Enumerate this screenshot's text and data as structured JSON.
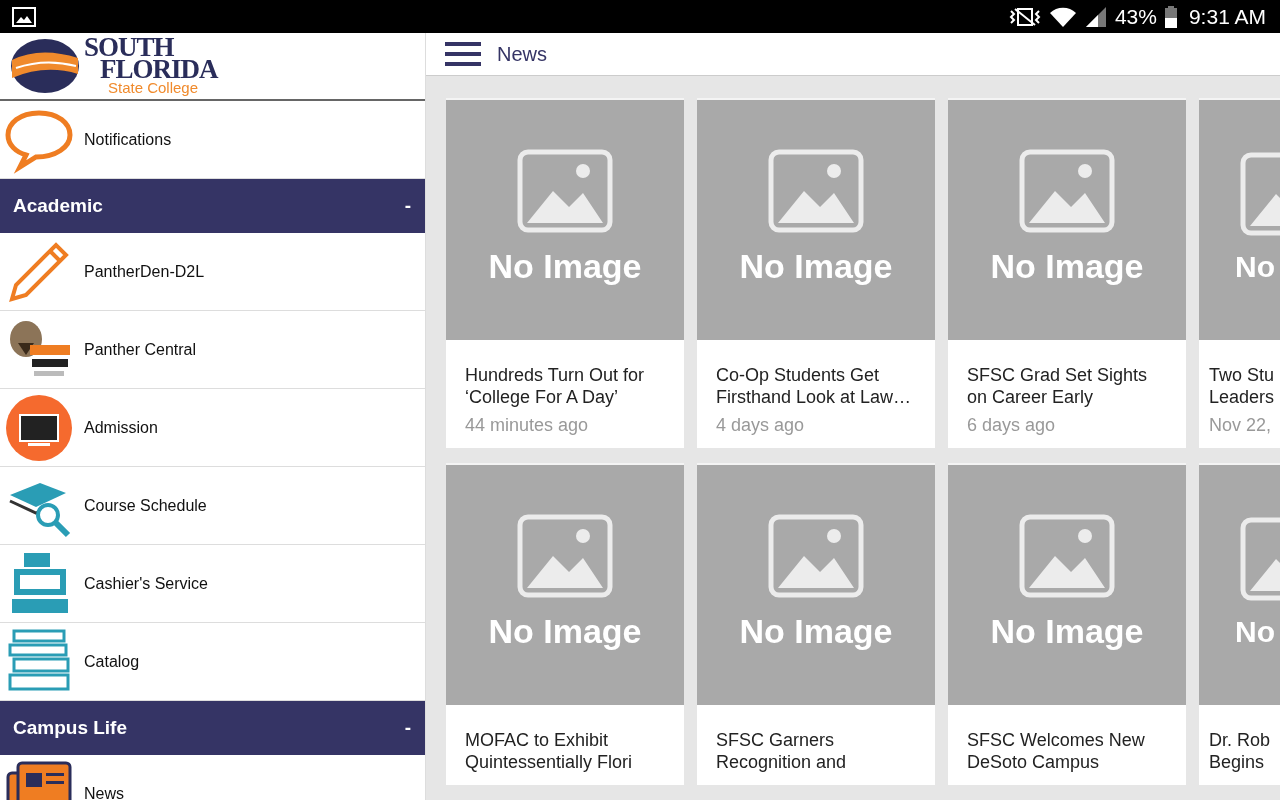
{
  "status_bar": {
    "battery": "43%",
    "time": "9:31 AM"
  },
  "logo": {
    "line_1": "SOUTH",
    "line_2": "FLORIDA",
    "line_3": "State College"
  },
  "sidebar": {
    "items": [
      {
        "kind": "item",
        "label": "Notifications"
      },
      {
        "kind": "header",
        "label": "Academic",
        "toggle": "-"
      },
      {
        "kind": "item",
        "label": "PantherDen-D2L"
      },
      {
        "kind": "item",
        "label": "Panther Central"
      },
      {
        "kind": "item",
        "label": "Admission"
      },
      {
        "kind": "item",
        "label": "Course Schedule"
      },
      {
        "kind": "item",
        "label": "Cashier's Service"
      },
      {
        "kind": "item",
        "label": "Catalog"
      },
      {
        "kind": "header",
        "label": "Campus Life",
        "toggle": "-"
      },
      {
        "kind": "item",
        "label": "News"
      }
    ]
  },
  "toolbar": {
    "title": "News"
  },
  "news_cards": [
    [
      {
        "image_label": "No Image",
        "title": "Hundreds Turn Out for\n‘College For A Day’",
        "time": "44 minutes ago"
      },
      {
        "image_label": "No Image",
        "title": "Co-Op Students Get\nFirsthand Look at Law…",
        "time": "4 days ago"
      },
      {
        "image_label": "No Image",
        "title": "SFSC Grad Set Sights\non Career Early",
        "time": "6 days ago"
      },
      {
        "image_label": "No",
        "title": "Two Stu\nLeaders",
        "time": "Nov 22,"
      }
    ],
    [
      {
        "image_label": "No Image",
        "title": "MOFAC to Exhibit\nQuintessentially Flori"
      },
      {
        "image_label": "No Image",
        "title": "SFSC Garners\nRecognition and"
      },
      {
        "image_label": "No Image",
        "title": "SFSC Welcomes New\nDeSoto Campus"
      },
      {
        "image_label": "No",
        "title": "Dr. Rob\nBegins"
      }
    ]
  ]
}
